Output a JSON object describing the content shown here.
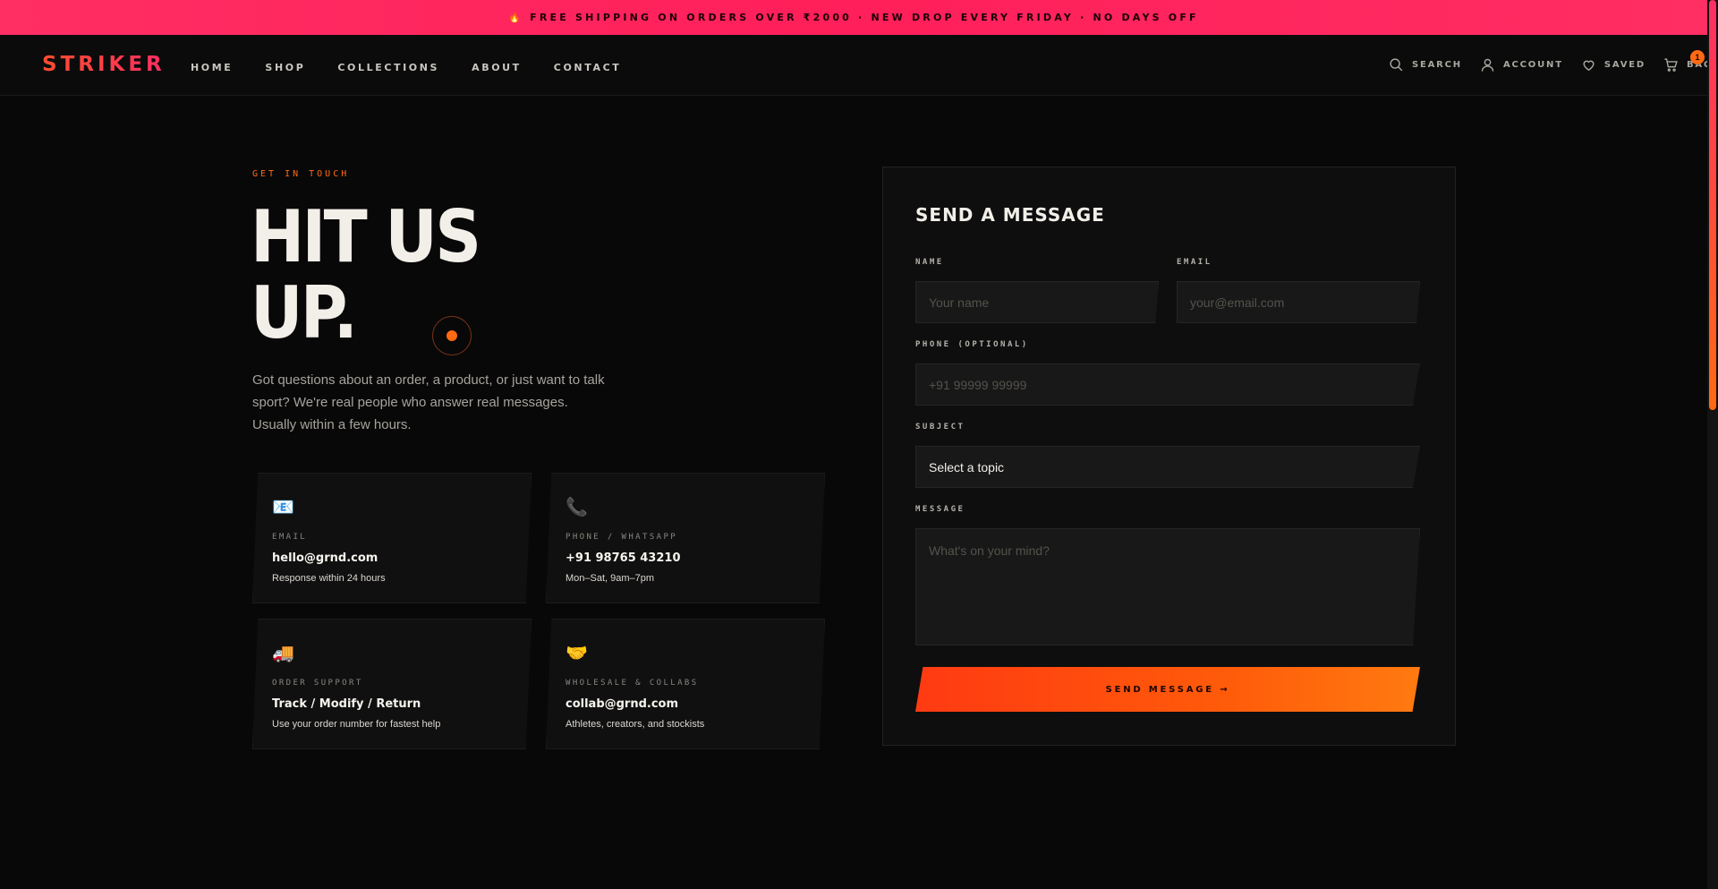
{
  "promo": {
    "text": "🔥 FREE SHIPPING ON ORDERS OVER ₹2000 · NEW DROP EVERY FRIDAY · NO DAYS OFF"
  },
  "nav": {
    "logo": "STRIKER",
    "items": [
      "HOME",
      "SHOP",
      "COLLECTIONS",
      "ABOUT",
      "CONTACT"
    ],
    "utilities": {
      "search": "SEARCH",
      "account": "ACCOUNT",
      "saved": "SAVED",
      "bag": "BAG",
      "bag_count": "1"
    }
  },
  "contact": {
    "eyebrow": "GET IN TOUCH",
    "headline_line1": "HIT US",
    "headline_line2": "UP.",
    "intro": "Got questions about an order, a product, or just want to talk sport? We're real people who answer real messages. Usually within a few hours.",
    "cards": [
      {
        "icon": "📧",
        "label": "EMAIL",
        "value": "hello@grnd.com",
        "sub": "Response within 24 hours"
      },
      {
        "icon": "📞",
        "label": "PHONE / WHATSAPP",
        "value": "+91 98765 43210",
        "sub": "Mon–Sat, 9am–7pm"
      },
      {
        "icon": "🚚",
        "label": "ORDER SUPPORT",
        "value": "Track / Modify / Return",
        "sub": "Use your order number for fastest help"
      },
      {
        "icon": "🤝",
        "label": "WHOLESALE & COLLABS",
        "value": "collab@grnd.com",
        "sub": "Athletes, creators, and stockists"
      }
    ]
  },
  "form": {
    "title": "SEND A MESSAGE",
    "name_label": "NAME",
    "name_placeholder": "Your name",
    "email_label": "EMAIL",
    "email_placeholder": "your@email.com",
    "phone_label": "PHONE (OPTIONAL)",
    "phone_placeholder": "+91 99999 99999",
    "subject_label": "SUBJECT",
    "subject_value": "Select a topic",
    "message_label": "MESSAGE",
    "message_placeholder": "What's on your mind?",
    "submit_label": "SEND MESSAGE →"
  },
  "colors": {
    "accent": "#ff6a13",
    "promo": "#ff2e63",
    "background": "#080808"
  }
}
